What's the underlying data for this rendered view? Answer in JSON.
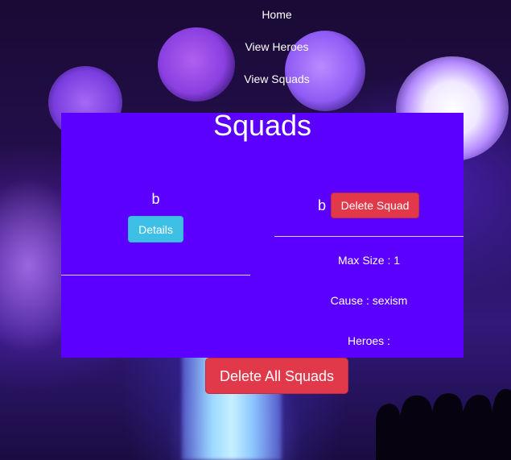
{
  "nav": {
    "home": "Home",
    "view_heroes": "View Heroes",
    "view_squads": "View Squads"
  },
  "page": {
    "title": "Squads"
  },
  "squads": [
    {
      "name": "b",
      "details_label": "Details"
    },
    {
      "name": "b",
      "delete_label": "Delete Squad",
      "max_size": "Max Size : 1",
      "cause": "Cause : sexism",
      "heroes": "Heroes :"
    }
  ],
  "actions": {
    "delete_all_label": "Delete All Squads"
  },
  "colors": {
    "panel": "#5b00ff",
    "details_button": "#3ec0e6",
    "delete_button": "#e2394a"
  }
}
